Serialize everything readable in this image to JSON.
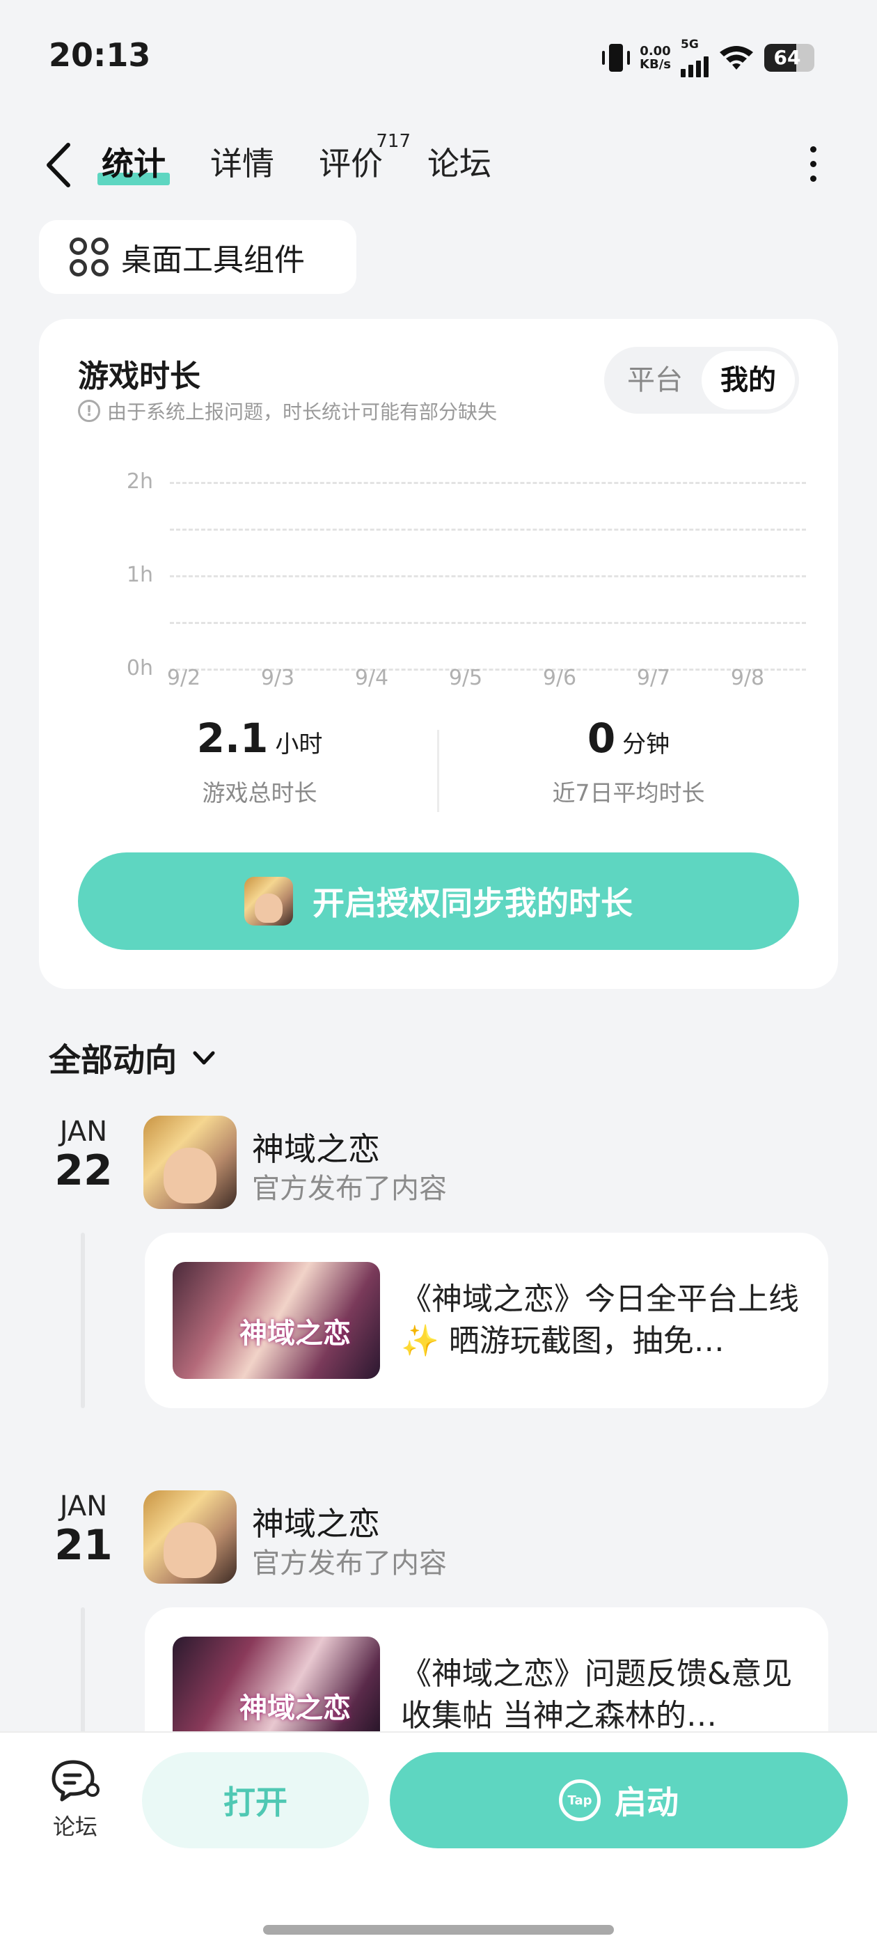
{
  "status": {
    "time": "20:13",
    "net_speed": "0.00",
    "net_unit": "KB/s",
    "signal": "5G",
    "battery": "64"
  },
  "nav": {
    "tabs": [
      {
        "label": "统计",
        "active": true
      },
      {
        "label": "详情",
        "active": false
      },
      {
        "label": "评价",
        "badge": "717",
        "active": false
      },
      {
        "label": "论坛",
        "active": false
      }
    ]
  },
  "widget_button": {
    "label": "桌面工具组件"
  },
  "stats": {
    "title": "游戏时长",
    "note": "由于系统上报问题，时长统计可能有部分缺失",
    "segment": {
      "options": [
        "平台",
        "我的"
      ],
      "selected": "我的"
    },
    "chart": {
      "y_ticks": [
        "2h",
        "1h",
        "0h"
      ],
      "x_ticks": [
        "9/2",
        "9/3",
        "9/4",
        "9/5",
        "9/6",
        "9/7",
        "9/8"
      ]
    },
    "total": {
      "value": "2.1",
      "unit": "小时",
      "label": "游戏总时长"
    },
    "avg": {
      "value": "0",
      "unit": "分钟",
      "label": "近7日平均时长"
    },
    "sync_button": "开启授权同步我的时长"
  },
  "feed": {
    "filter_label": "全部动向",
    "posts": [
      {
        "month": "JAN",
        "day": "22",
        "name": "神域之恋",
        "action": "官方发布了内容",
        "thumb_text": "神域之恋",
        "text": "《神域之恋》今日全平台上线✨ 晒游玩截图，抽免…"
      },
      {
        "month": "JAN",
        "day": "21",
        "name": "神域之恋",
        "action": "官方发布了内容",
        "thumb_text": "神域之恋",
        "text": "《神域之恋》问题反馈&意见收集帖 当神之森林的…"
      }
    ]
  },
  "bottom": {
    "forum_label": "论坛",
    "open_label": "打开",
    "start_label": "启动",
    "tap_logo": "Tap"
  }
}
